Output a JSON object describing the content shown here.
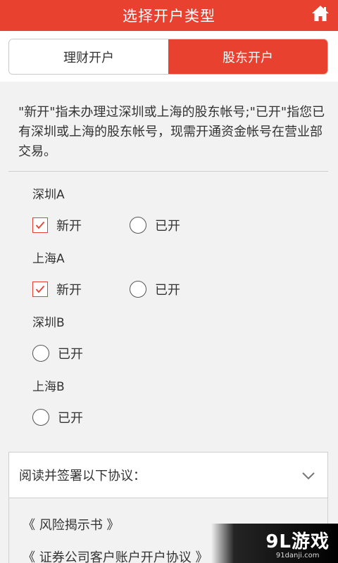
{
  "header": {
    "title": "选择开户类型",
    "home_icon": "home-icon"
  },
  "tabs": [
    {
      "label": "理财开户",
      "active": false
    },
    {
      "label": "股东开户",
      "active": true
    }
  ],
  "description": "\"新开\"指未办理过深圳或上海的股东帐号;\"已开\"指您已有深圳或上海的股东帐号，现需开通资金帐号在营业部交易。",
  "groups": [
    {
      "label": "深圳A",
      "options": [
        {
          "label": "新开",
          "type": "checkbox",
          "checked": true
        },
        {
          "label": "已开",
          "type": "radio",
          "checked": false
        }
      ]
    },
    {
      "label": "上海A",
      "options": [
        {
          "label": "新开",
          "type": "checkbox",
          "checked": true
        },
        {
          "label": "已开",
          "type": "radio",
          "checked": false
        }
      ]
    },
    {
      "label": "深圳B",
      "options": [
        {
          "label": "已开",
          "type": "radio",
          "checked": false
        }
      ]
    },
    {
      "label": "上海B",
      "options": [
        {
          "label": "已开",
          "type": "radio",
          "checked": false
        }
      ]
    }
  ],
  "agreement_section": {
    "title": "阅读并签署以下协议：",
    "items": [
      "《 风险揭示书 》",
      "《 证券公司客户账户开户协议 》"
    ]
  },
  "watermark": {
    "main": "9L游戏",
    "sub": "91danji.com"
  },
  "colors": {
    "accent": "#e8412f",
    "background": "#f2f2f2"
  }
}
